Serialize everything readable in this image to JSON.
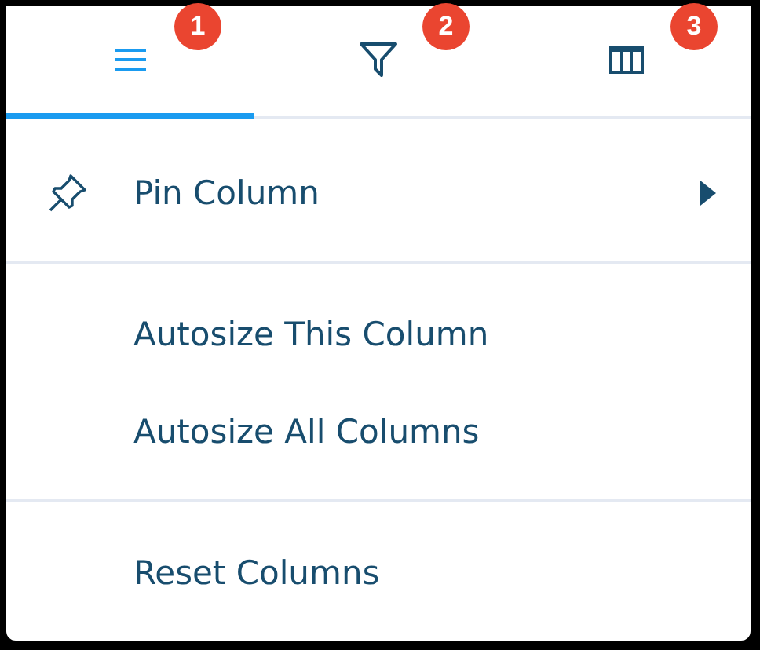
{
  "tabs": [
    {
      "kind": "menu",
      "selected": true,
      "badge": "1"
    },
    {
      "kind": "filter",
      "selected": false,
      "badge": "2"
    },
    {
      "kind": "columns",
      "selected": false,
      "badge": "3"
    }
  ],
  "menu": [
    {
      "kind": "submenu",
      "label": "Pin Column"
    },
    {
      "kind": "separator"
    },
    {
      "kind": "item",
      "label": "Autosize This Column"
    },
    {
      "kind": "item",
      "label": "Autosize All Columns"
    },
    {
      "kind": "separator"
    },
    {
      "kind": "item",
      "label": "Reset Columns"
    }
  ]
}
